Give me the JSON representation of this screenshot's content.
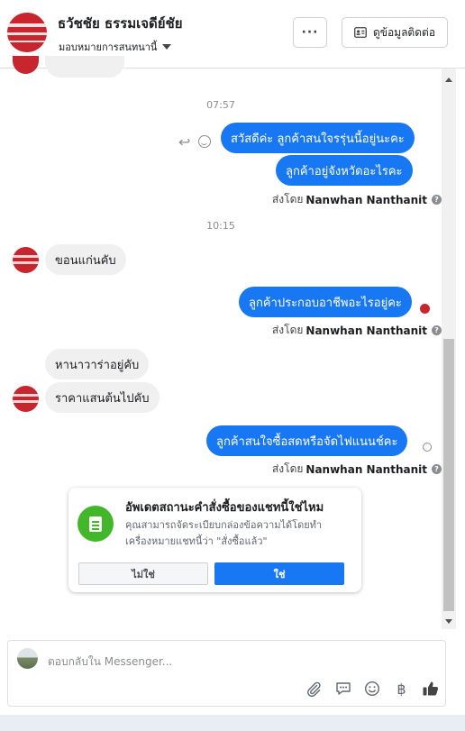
{
  "header": {
    "contact_name": "ธวัชชัย ธรรมเจดีย์ชัย",
    "assign_label": "มอบหมายการสนทนานี้",
    "more_label": "···",
    "contact_info_label": "ดูข้อมูลติดต่อ"
  },
  "thread": {
    "time_1": "07:57",
    "msg_out_1": "สวัสดีค่ะ ลูกค้าสนใจรรุ่นนี้อยู่นะคะ",
    "msg_out_2": "ลูกค้าอยู่จังหวัดอะไรคะ",
    "sent_by_prefix": "ส่งโดย",
    "sent_by_name": "Nanwhan Nanthanit",
    "time_2": "10:15",
    "msg_in_1": "ขอนแก่นคับ",
    "msg_out_3": "ลูกค้าประกอบอาชีพอะไรอยู่คะ",
    "msg_in_2": "หานาวาร่าอยู่คับ",
    "msg_in_3": "ราคาแสนต้นไปคับ",
    "msg_out_4": "ลูกค้าสนใจซื้อสดหรือจัดไฟแนนช์คะ",
    "help_glyph": "?"
  },
  "order_prompt": {
    "title": "อัพเดตสถานะคำสั่งซื้อของแชทนี้ใช่ไหม",
    "description": "คุณสามารถจัดระเบียบกล่องข้อความได้โดยทำเครื่องหมายแชทนี้ว่า \"สั่งซื้อแล้ว\"",
    "no_label": "ไม่ใช่",
    "yes_label": "ใช่"
  },
  "composer": {
    "placeholder": "ตอบกลับใน Messenger...",
    "tools": [
      "paperclip-icon",
      "saved-reply-icon",
      "emoji-icon",
      "baht-icon",
      "thumbs-up-icon"
    ],
    "baht_glyph": "฿"
  },
  "colors": {
    "accent": "#1877f2",
    "incoming_bubble": "#f0f0f0",
    "prompt_icon": "#42b72a",
    "avatar": "#c7262f"
  }
}
